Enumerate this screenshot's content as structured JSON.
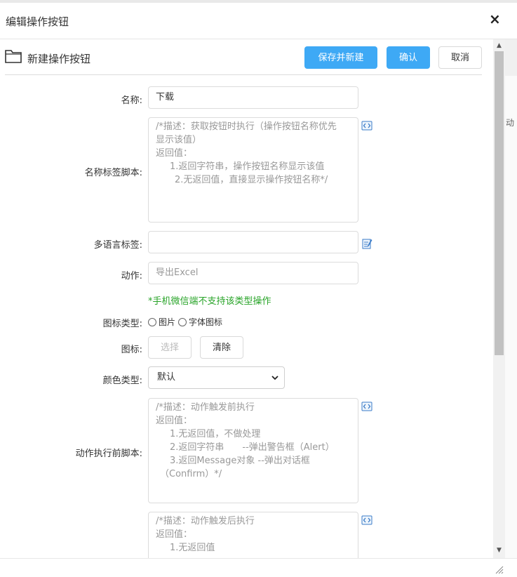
{
  "dialog": {
    "title": "编辑操作按钮",
    "close_label": "×"
  },
  "toolbar": {
    "title": "新建操作按钮",
    "save_new_label": "保存并新建",
    "confirm_label": "确认",
    "cancel_label": "取消",
    "primary_color": "#3ea9f5"
  },
  "form": {
    "name": {
      "label": "名称:",
      "value": "下载"
    },
    "name_script": {
      "label": "名称标签脚本:",
      "lines": [
        "/*描述：获取按钮时执行（操作按钮名称优先",
        "显示该值）",
        "返回值：",
        "1.返回字符串，操作按钮名称显示该值",
        "2.无返回值，直接显示操作按钮名称*/"
      ]
    },
    "multilang": {
      "label": "多语言标签:",
      "value": ""
    },
    "action": {
      "label": "动作:",
      "value": "导出Excel"
    },
    "hint": "*手机微信端不支持该类型操作",
    "icon_type": {
      "label": "图标类型:",
      "options": [
        "图片",
        "字体图标"
      ]
    },
    "icon": {
      "label": "图标:",
      "select_label": "选择",
      "clear_label": "清除"
    },
    "color_type": {
      "label": "颜色类型:",
      "value": "默认"
    },
    "before_script": {
      "label": "动作执行前脚本:",
      "lines": [
        "/*描述：动作触发前执行",
        "返回值：",
        "1.无返回值，不做处理",
        "2.返回字符串　　--弹出警告框（Alert）",
        "3.返回Message对象 --弹出对话框",
        "（Confirm）*/"
      ]
    },
    "after_script": {
      "lines": [
        "/*描述：动作触发后执行",
        "返回值：",
        "1.无返回值"
      ]
    }
  },
  "side_panel": {
    "fragment": "动"
  },
  "icons": {
    "folder": "folder-icon",
    "code_edit": "code-edit-icon",
    "translate": "translate-edit-icon",
    "chevron": "chevron-down-icon"
  },
  "colors": {
    "hint_green": "#28a428"
  }
}
